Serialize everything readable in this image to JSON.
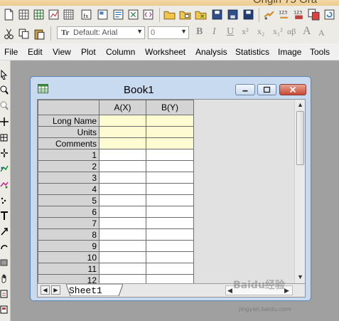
{
  "app": {
    "title_partial": "Origin 75 Gra"
  },
  "format_toolbar": {
    "font_name": "Default: Arial",
    "font_size": "0",
    "bold": "B",
    "italic": "I",
    "underline": "U",
    "superscript": "x²",
    "subscript": "x₂",
    "supsub": "x₁²",
    "greek": "αβ",
    "increase_font": "A",
    "decrease_font": "A"
  },
  "menu": [
    "File",
    "Edit",
    "View",
    "Plot",
    "Column",
    "Worksheet",
    "Analysis",
    "Statistics",
    "Image",
    "Tools"
  ],
  "book": {
    "title": "Book1",
    "columns": [
      "A(X)",
      "B(Y)"
    ],
    "label_rows": [
      "Long Name",
      "Units",
      "Comments"
    ],
    "data_rows": [
      "1",
      "2",
      "3",
      "4",
      "5",
      "6",
      "7",
      "8",
      "9",
      "10",
      "11",
      "12"
    ],
    "sheet_tab": "Sheet1"
  },
  "watermark": {
    "brand": "Baidu经验",
    "url": "jingyan.baidu.com"
  },
  "colors": {
    "label_row_bg": "#fdfbd2",
    "header_bg": "#d4d4d4",
    "window_frame": "#c7daf0",
    "close_button": "#c74a34",
    "workspace": "#a0a0a0"
  }
}
